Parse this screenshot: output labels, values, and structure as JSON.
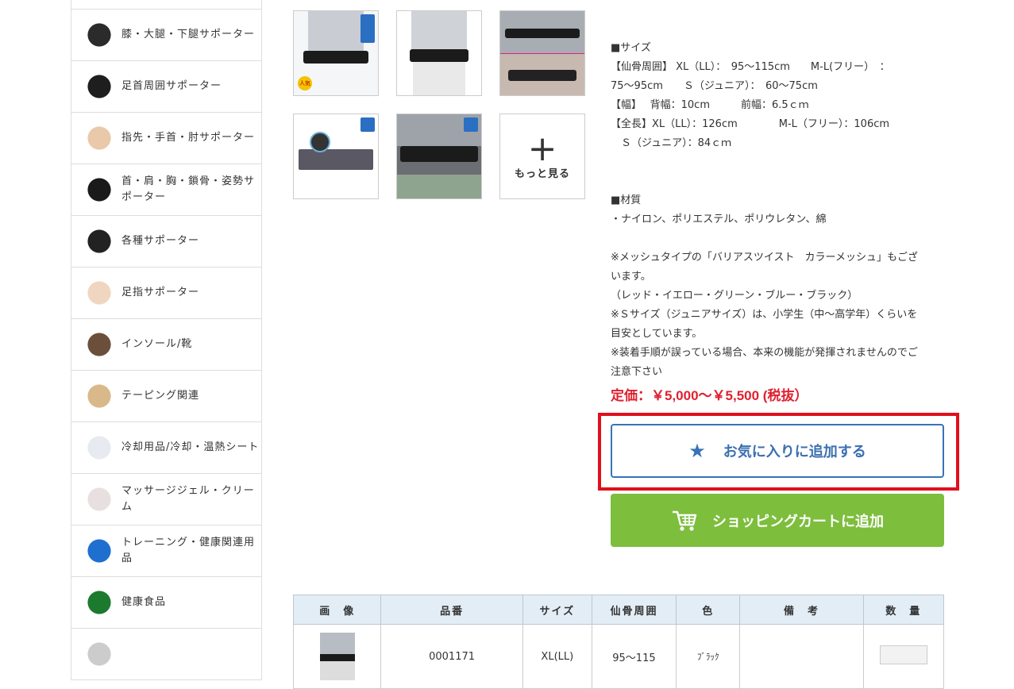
{
  "sidebar": {
    "items": [
      {
        "label": ""
      },
      {
        "label": "膝・大腿・下腿サポーター",
        "icon": "knee-support-icon"
      },
      {
        "label": "足首周囲サポーター",
        "icon": "ankle-support-icon"
      },
      {
        "label": "指先・手首・肘サポーター",
        "icon": "wrist-support-icon"
      },
      {
        "label": "首・肩・胸・鎖骨・姿勢サポーター",
        "icon": "neck-support-icon"
      },
      {
        "label": "各種サポーター",
        "icon": "heel-support-icon"
      },
      {
        "label": "足指サポーター",
        "icon": "toe-support-icon"
      },
      {
        "label": "インソール/靴",
        "icon": "insole-icon"
      },
      {
        "label": "テーピング関連",
        "icon": "taping-icon"
      },
      {
        "label": "冷却用品/冷却・温熱シート",
        "icon": "cooling-sheet-icon"
      },
      {
        "label": "マッサージジェル・クリーム",
        "icon": "massage-gel-icon"
      },
      {
        "label": "トレーニング・健康関連用品",
        "icon": "training-ball-icon"
      },
      {
        "label": "健康食品",
        "icon": "health-food-icon"
      },
      {
        "label": "",
        "icon": "more-category-icon"
      }
    ]
  },
  "gallery": {
    "more_label": "もっと見る",
    "badge_text": "人気"
  },
  "description": {
    "lines": [
      "■サイズ",
      "【仙骨周囲】 XL（LL）：　95〜115cm　　M-L(フリー）　：",
      "75〜95cm　　Ｓ（ジュニア）：　60〜75cm",
      "【幅】　 背幅：10cm　　　前幅：6.5ｃｍ",
      "【全長】XL（LL）：126cm　　　　M-L（フリー）：106cm",
      "　Ｓ（ジュニア）：84ｃｍ",
      "",
      "",
      "■材質",
      "・ナイロン、ポリエステル、ポリウレタン、綿",
      "",
      "※メッシュタイプの「バリアスツイスト　カラーメッシュ」もござ",
      "います。",
      "（レッド・イエロー・グリーン・ブルー・ブラック）",
      "※Ｓサイズ（ジュニアサイズ）は、小学生（中〜高学年）くらいを",
      "目安としています。",
      "※装着手順が誤っている場合、本来の機能が発揮されませんのでご",
      "注意下さい"
    ],
    "price": "定価：￥5,000〜￥5,500 (税抜）"
  },
  "actions": {
    "favorite_label": "お気に入りに追加する",
    "cart_label": "ショッピングカートに追加"
  },
  "table": {
    "headers": [
      "画　像",
      "品番",
      "サイズ",
      "仙骨周囲",
      "色",
      "備　考",
      "数　量"
    ],
    "rows": [
      {
        "code": "0001171",
        "size": "XL(LL)",
        "range": "95〜115",
        "color": "ﾌﾞﾗｯｸ",
        "note": ""
      }
    ]
  },
  "colors": {
    "accent_blue": "#3873b8",
    "cart_green": "#7dbe3d",
    "price_red": "#e0202f",
    "highlight_red": "#e0101c",
    "table_header_bg": "#e3edf6"
  }
}
